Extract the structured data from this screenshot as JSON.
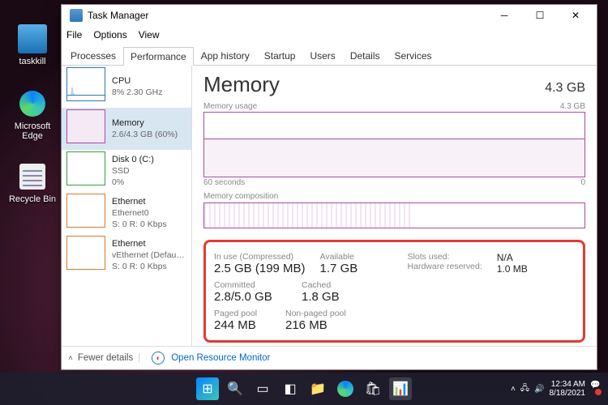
{
  "desktop": {
    "icons": [
      {
        "name": "taskkill"
      },
      {
        "name": "Microsoft Edge"
      },
      {
        "name": "Recycle Bin"
      }
    ]
  },
  "window": {
    "title": "Task Manager"
  },
  "menu": [
    "File",
    "Options",
    "View"
  ],
  "tabs": [
    "Processes",
    "Performance",
    "App history",
    "Startup",
    "Users",
    "Details",
    "Services"
  ],
  "active_tab": "Performance",
  "sidebar": [
    {
      "name": "CPU",
      "sub1": "8% 2.30 GHz",
      "sub2": ""
    },
    {
      "name": "Memory",
      "sub1": "2.6/4.3 GB (60%)",
      "sub2": ""
    },
    {
      "name": "Disk 0 (C:)",
      "sub1": "SSD",
      "sub2": "0%"
    },
    {
      "name": "Ethernet",
      "sub1": "Ethernet0",
      "sub2": "S: 0 R: 0 Kbps"
    },
    {
      "name": "Ethernet",
      "sub1": "vEthernet (Default ...",
      "sub2": "S: 0 R: 0 Kbps"
    }
  ],
  "main": {
    "title": "Memory",
    "total": "4.3 GB",
    "usage_label": "Memory usage",
    "usage_max": "4.3 GB",
    "time_left": "60 seconds",
    "time_right": "0",
    "composition_label": "Memory composition",
    "stats": {
      "in_use_label": "In use (Compressed)",
      "in_use": "2.5 GB (199 MB)",
      "available_label": "Available",
      "available": "1.7 GB",
      "slots_label": "Slots used:",
      "slots": "N/A",
      "hw_label": "Hardware reserved:",
      "hw": "1.0 MB",
      "committed_label": "Committed",
      "committed": "2.8/5.0 GB",
      "cached_label": "Cached",
      "cached": "1.8 GB",
      "paged_label": "Paged pool",
      "paged": "244 MB",
      "nonpaged_label": "Non-paged pool",
      "nonpaged": "216 MB"
    }
  },
  "footer": {
    "fewer": "Fewer details",
    "resmon": "Open Resource Monitor"
  },
  "clock": {
    "time": "12:34 AM",
    "date": "8/18/2021"
  }
}
